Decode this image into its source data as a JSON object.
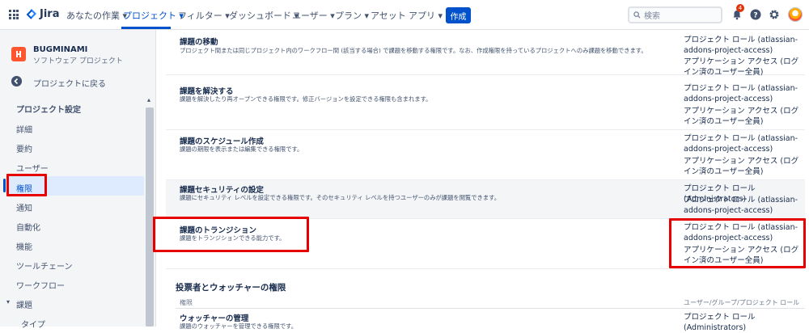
{
  "header": {
    "logo_text": "Jira",
    "nav": [
      "あなたの作業 ▾",
      "プロジェクト ▾",
      "フィルター ▾",
      "ダッシュボード ▾",
      "ユーザー ▾",
      "プラン ▾",
      "アセット",
      "アプリ ▾"
    ],
    "create_label": "作成",
    "search_placeholder": "検索",
    "notification_count": "4"
  },
  "sidebar": {
    "project_name": "BUGMINAMI",
    "project_type": "ソフトウェア プロジェクト",
    "back_label": "プロジェクトに戻る",
    "section_title": "プロジェクト設定",
    "items": [
      "詳細",
      "要約",
      "ユーザー",
      "権限",
      "通知",
      "自動化",
      "機能",
      "ツールチェーン",
      "ワークフロー",
      "課題",
      "タイプ"
    ]
  },
  "permissions": [
    {
      "title": "課題の移動",
      "desc": "プロジェクト間または同じプロジェクト内のワークフロー間 (該当する場合) で課題を移動する権限です。なお、作成権限を持っているプロジェクトへのみ課題を移動できます。",
      "grants": [
        "プロジェクト ロール (atlassian-addons-project-access)",
        "アプリケーション アクセス (ログイン済のユーザー全員)"
      ]
    },
    {
      "title": "課題を解決する",
      "desc": "課題を解決したり再オープンできる権限です。修正バージョンを設定できる権限も含まれます。",
      "grants": [
        "プロジェクト ロール (atlassian-addons-project-access)",
        "アプリケーション アクセス (ログイン済のユーザー全員)"
      ]
    },
    {
      "title": "課題のスケジュール作成",
      "desc": "課題の期限を表示または編集できる権限です。",
      "grants": [
        "プロジェクト ロール (atlassian-addons-project-access)",
        "アプリケーション アクセス (ログイン済のユーザー全員)"
      ]
    },
    {
      "title": "課題セキュリティの設定",
      "desc": "課題にセキュリティ レベルを設定できる権限です。そのセキュリティ レベルを持つユーザーのみが課題を閲覧できます。",
      "grants": [
        "プロジェクト ロール (Administrators)",
        "プロジェクト ロール (atlassian-addons-project-access)"
      ]
    },
    {
      "title": "課題のトランジション",
      "desc": "課題をトランジションできる能力です。",
      "grants": [
        "プロジェクト ロール (atlassian-addons-project-access)",
        "アプリケーション アクセス (ログイン済のユーザー全員)"
      ]
    }
  ],
  "voters_section": {
    "title": "投票者とウォッチャーの権限",
    "col_permission": "権限",
    "col_grants": "ユーザー/グループ/プロジェクト ロール",
    "row_title": "ウォッチャーの管理",
    "row_desc": "課題のウォッチャーを管理できる権限です。",
    "row_grant": "プロジェクト ロール (Administrators)"
  },
  "colors": {
    "accent": "#0052cc",
    "highlight": "#e60000"
  }
}
